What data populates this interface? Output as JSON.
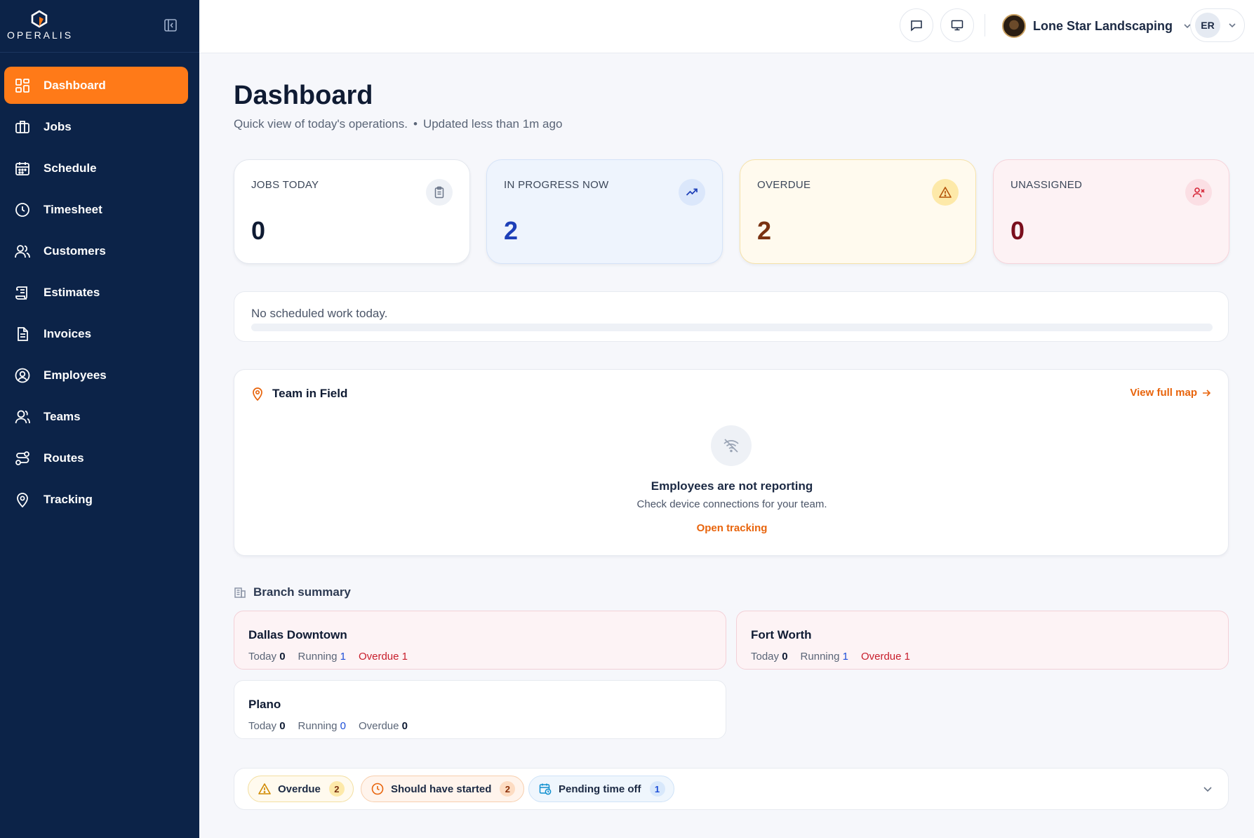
{
  "brand": {
    "name": "OPERALIS"
  },
  "sidebar": {
    "items": [
      {
        "label": "Dashboard",
        "icon": "dashboard-icon",
        "active": true
      },
      {
        "label": "Jobs",
        "icon": "briefcase-icon"
      },
      {
        "label": "Schedule",
        "icon": "calendar-icon"
      },
      {
        "label": "Timesheet",
        "icon": "clock-icon"
      },
      {
        "label": "Customers",
        "icon": "users-icon"
      },
      {
        "label": "Estimates",
        "icon": "scroll-icon"
      },
      {
        "label": "Invoices",
        "icon": "document-icon"
      },
      {
        "label": "Employees",
        "icon": "user-circle-icon"
      },
      {
        "label": "Teams",
        "icon": "team-icon"
      },
      {
        "label": "Routes",
        "icon": "route-icon"
      },
      {
        "label": "Tracking",
        "icon": "map-pin-icon"
      }
    ]
  },
  "topbar": {
    "company": "Lone Star Landscaping",
    "user_initials": "ER"
  },
  "header": {
    "title": "Dashboard",
    "subtitle": "Quick view of today's operations.",
    "separator": "•",
    "updated": "Updated less than 1m ago"
  },
  "stats": [
    {
      "label": "JOBS TODAY",
      "value": "0",
      "icon": "clipboard-icon"
    },
    {
      "label": "IN PROGRESS NOW",
      "value": "2",
      "icon": "trending-up-icon"
    },
    {
      "label": "OVERDUE",
      "value": "2",
      "icon": "warning-icon"
    },
    {
      "label": "UNASSIGNED",
      "value": "0",
      "icon": "user-x-icon"
    }
  ],
  "schedule": {
    "text": "No scheduled work today.",
    "progress": 0
  },
  "team_in_field": {
    "title": "Team in Field",
    "map_link": "View full map",
    "empty_title": "Employees are not reporting",
    "empty_sub": "Check device connections for your team.",
    "empty_link": "Open tracking"
  },
  "branch_summary": {
    "title": "Branch summary",
    "labels": {
      "today": "Today",
      "running": "Running",
      "overdue": "Overdue"
    },
    "branches": [
      {
        "name": "Dallas Downtown",
        "today": "0",
        "running": "1",
        "overdue": "1"
      },
      {
        "name": "Fort Worth",
        "today": "0",
        "running": "1",
        "overdue": "1"
      },
      {
        "name": "Plano",
        "today": "0",
        "running": "0",
        "overdue": "0"
      }
    ]
  },
  "alerts": [
    {
      "label": "Overdue",
      "count": "2",
      "icon": "warning-icon"
    },
    {
      "label": "Should have started",
      "count": "2",
      "icon": "clock-icon"
    },
    {
      "label": "Pending time off",
      "count": "1",
      "icon": "calendar-clock-icon"
    }
  ],
  "colors": {
    "sidebar": "#0c2348",
    "accent": "#ff7a18",
    "link": "#e8640c"
  }
}
